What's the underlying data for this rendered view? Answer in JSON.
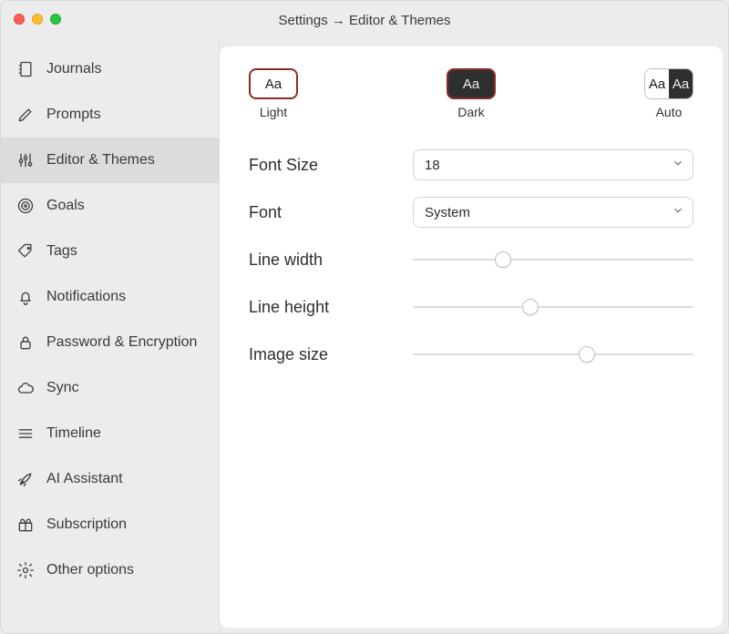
{
  "window": {
    "title": "Settings → Editor & Themes"
  },
  "sidebar": {
    "items": [
      {
        "id": "journals",
        "label": "Journals"
      },
      {
        "id": "prompts",
        "label": "Prompts"
      },
      {
        "id": "editor-themes",
        "label": "Editor & Themes"
      },
      {
        "id": "goals",
        "label": "Goals"
      },
      {
        "id": "tags",
        "label": "Tags"
      },
      {
        "id": "notifications",
        "label": "Notifications"
      },
      {
        "id": "password-encryption",
        "label": "Password & Encryption"
      },
      {
        "id": "sync",
        "label": "Sync"
      },
      {
        "id": "timeline",
        "label": "Timeline"
      },
      {
        "id": "ai-assistant",
        "label": "AI Assistant"
      },
      {
        "id": "subscription",
        "label": "Subscription"
      },
      {
        "id": "other",
        "label": "Other options"
      }
    ],
    "active_id": "editor-themes"
  },
  "themes": {
    "light": {
      "label": "Light",
      "sample": "Aa"
    },
    "dark": {
      "label": "Dark",
      "sample": "Aa"
    },
    "auto": {
      "label": "Auto",
      "sample": "Aa",
      "selected": true
    }
  },
  "settings": {
    "font_size": {
      "label": "Font Size",
      "value": "18"
    },
    "font": {
      "label": "Font",
      "value": "System"
    },
    "line_width": {
      "label": "Line width",
      "percent": 32
    },
    "line_height": {
      "label": "Line height",
      "percent": 42
    },
    "image_size": {
      "label": "Image size",
      "percent": 62
    }
  }
}
